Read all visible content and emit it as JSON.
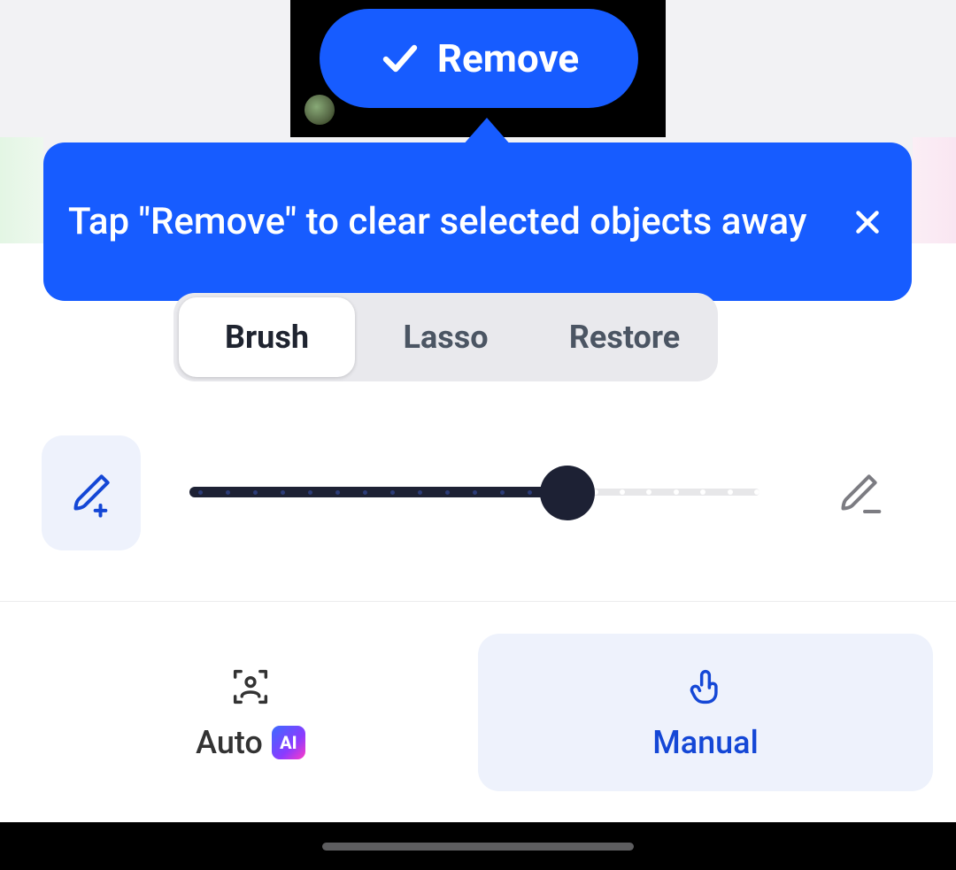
{
  "remove_button": {
    "label": "Remove"
  },
  "tooltip": {
    "text": "Tap \"Remove\" to clear selected objects away"
  },
  "tools": {
    "items": [
      "Brush",
      "Lasso",
      "Restore"
    ],
    "active_index": 0
  },
  "slider": {
    "value_percent": 66,
    "min": 0,
    "max": 100
  },
  "modes": {
    "auto": {
      "label": "Auto",
      "badge": "AI"
    },
    "manual": {
      "label": "Manual"
    },
    "active": "manual"
  },
  "colors": {
    "accent": "#175cff",
    "dark": "#1d2134",
    "manual_bg": "#eef2fc"
  }
}
